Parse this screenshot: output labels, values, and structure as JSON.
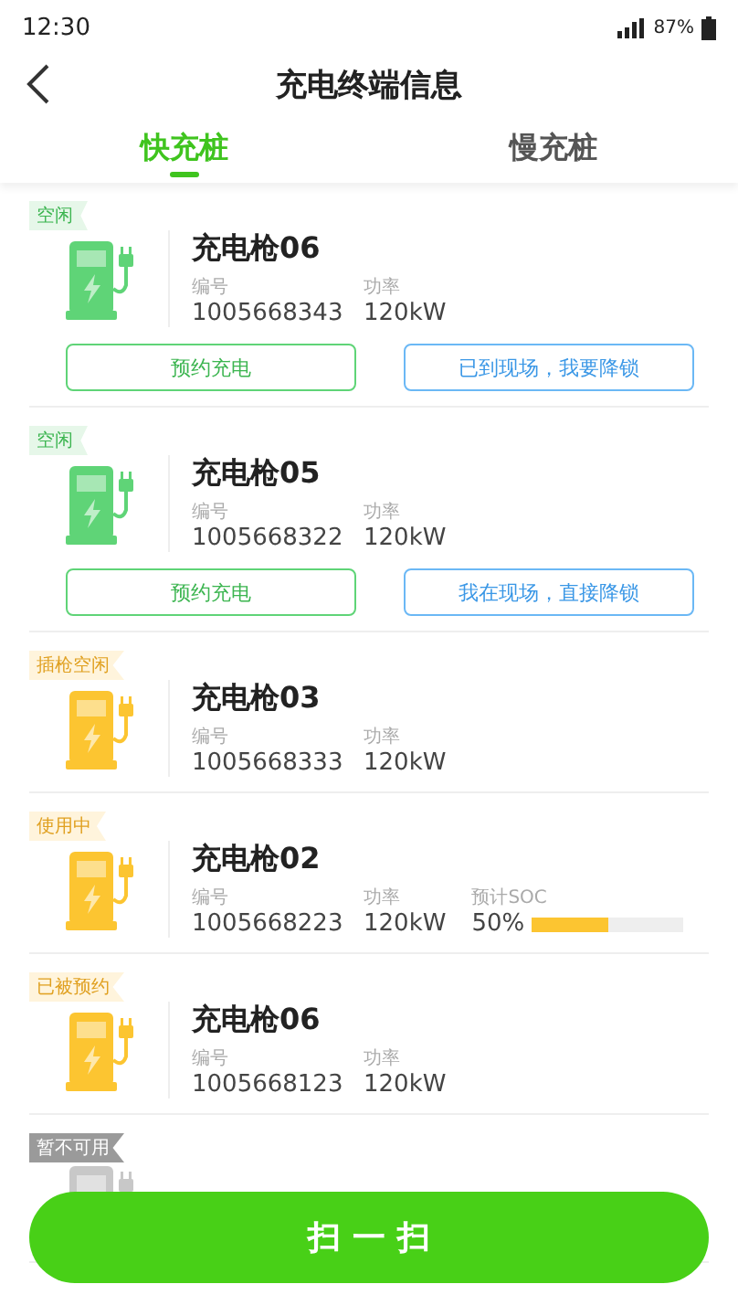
{
  "status_bar": {
    "time": "12:30",
    "battery_text": "87%"
  },
  "header": {
    "title": "充电终端信息"
  },
  "tabs": [
    {
      "label": "快充桩",
      "selected": true
    },
    {
      "label": "慢充桩",
      "selected": false
    }
  ],
  "chargers": [
    {
      "status": "空闲",
      "kind": "idle",
      "name": "充电枪06",
      "id_label": "编号",
      "id": "1005668343",
      "power_label": "功率",
      "power": "120kW",
      "actions": [
        {
          "label": "预约充电",
          "kind": "reserve"
        },
        {
          "label": "已到现场，我要降锁",
          "kind": "unlock"
        }
      ]
    },
    {
      "status": "空闲",
      "kind": "idle",
      "name": "充电枪05",
      "id_label": "编号",
      "id": "1005668322",
      "power_label": "功率",
      "power": "120kW",
      "actions": [
        {
          "label": "预约充电",
          "kind": "reserve"
        },
        {
          "label": "我在现场，直接降锁",
          "kind": "unlock"
        }
      ]
    },
    {
      "status": "插枪空闲",
      "kind": "busy",
      "name": "充电枪03",
      "id_label": "编号",
      "id": "1005668333",
      "power_label": "功率",
      "power": "120kW"
    },
    {
      "status": "使用中",
      "kind": "busy",
      "name": "充电枪02",
      "id_label": "编号",
      "id": "1005668223",
      "power_label": "功率",
      "power": "120kW",
      "soc_label": "预计SOC",
      "soc": "50%",
      "level": 0.5
    },
    {
      "status": "已被预约",
      "kind": "busy",
      "name": "充电枪06",
      "id_label": "编号",
      "id": "1005668123",
      "power_label": "功率",
      "power": "120kW"
    },
    {
      "status": "暂不可用",
      "kind": "unavailable"
    }
  ],
  "scan_button": "扫 一 扫"
}
